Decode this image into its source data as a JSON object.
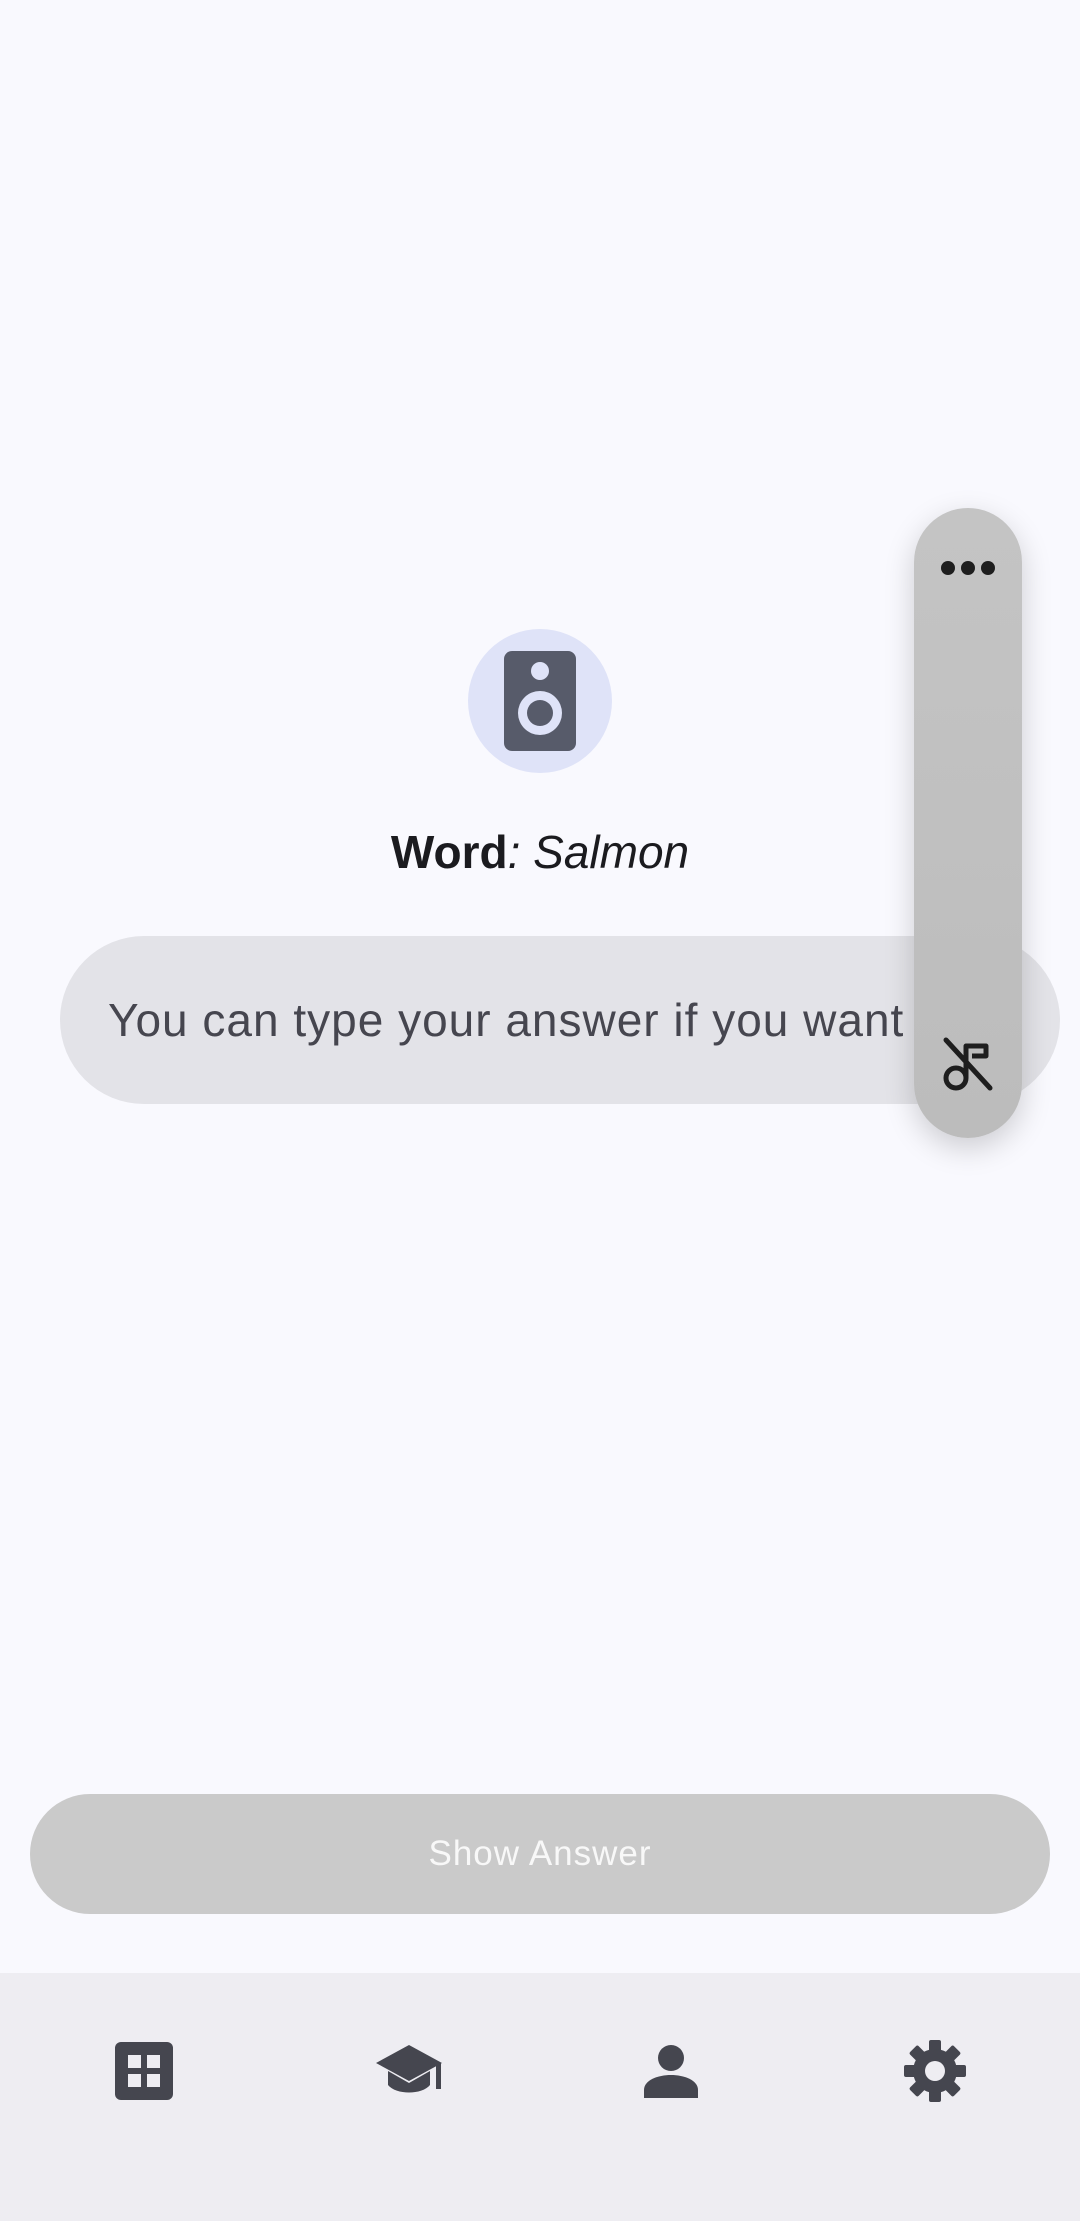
{
  "word": {
    "label": "Word",
    "separator": ": ",
    "value": "Salmon"
  },
  "answer_input": {
    "placeholder": "You can type your answer if you want",
    "value": ""
  },
  "speaker_button": {
    "icon": "speaker-icon"
  },
  "side_panel": {
    "more_icon": "more-horizontal-icon",
    "mute_icon": "music-off-icon"
  },
  "show_answer_button": {
    "label": "Show Answer"
  },
  "bottom_nav": {
    "items": [
      {
        "id": "dashboard",
        "icon": "grid-icon"
      },
      {
        "id": "learn",
        "icon": "graduation-cap-icon"
      },
      {
        "id": "profile",
        "icon": "person-icon"
      },
      {
        "id": "settings",
        "icon": "gear-icon"
      }
    ]
  },
  "colors": {
    "background": "#f9f9fe",
    "speaker_bg": "#dfe3f8",
    "icon_dark": "#575b6a",
    "input_bg": "#e3e3e8",
    "button_disabled": "#cacaca",
    "nav_bg": "#eeedf2"
  }
}
